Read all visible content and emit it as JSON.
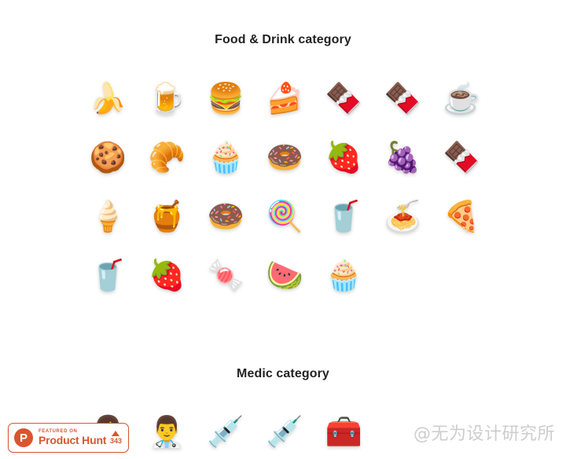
{
  "page": {
    "background_color": "#ffffff",
    "title_color": "#232323"
  },
  "sections": [
    {
      "id": "food",
      "title": "Food & Drink category",
      "rows": [
        [
          {
            "name": "banana-icon",
            "glyph": "🍌",
            "label": "banana"
          },
          {
            "name": "beer-mug-icon",
            "glyph": "🍺",
            "label": "beer mug"
          },
          {
            "name": "hamburger-icon",
            "glyph": "🍔",
            "label": "hamburger"
          },
          {
            "name": "heart-cake-icon",
            "glyph": "🍰",
            "label": "heart cake"
          },
          {
            "name": "chocolate-wrapper-icon",
            "glyph": "🍫",
            "label": "wrapped chocolate bar"
          },
          {
            "name": "chocolate-bar-icon",
            "glyph": "🍫",
            "label": "chocolate bar"
          },
          {
            "name": "coffee-cup-icon",
            "glyph": "☕",
            "label": "takeaway coffee cup"
          }
        ],
        [
          {
            "name": "cookies-icon",
            "glyph": "🍪",
            "label": "cookies"
          },
          {
            "name": "croissant-icon",
            "glyph": "🥐",
            "label": "croissant"
          },
          {
            "name": "cupcake-icon",
            "glyph": "🧁",
            "label": "cupcake"
          },
          {
            "name": "chocolate-donut-icon",
            "glyph": "🍩",
            "label": "chocolate donut"
          },
          {
            "name": "strawberry-icon",
            "glyph": "🍓",
            "label": "strawberries"
          },
          {
            "name": "grape-jelly-icon",
            "glyph": "🍇",
            "label": "purple jelly candy"
          },
          {
            "name": "ice-cream-bar-icon",
            "glyph": "🍫",
            "label": "chocolate ice cream bar"
          }
        ],
        [
          {
            "name": "ice-cream-cone-icon",
            "glyph": "🍦",
            "label": "ice cream cone"
          },
          {
            "name": "jam-jar-icon",
            "glyph": "🍯",
            "label": "jam jar"
          },
          {
            "name": "pink-donut-icon",
            "glyph": "🍩",
            "label": "pink sprinkle donut"
          },
          {
            "name": "lollipop-icon",
            "glyph": "🍭",
            "label": "lollipop"
          },
          {
            "name": "iced-drink-icon",
            "glyph": "🥤",
            "label": "iced drink cup"
          },
          {
            "name": "spaghetti-icon",
            "glyph": "🍝",
            "label": "spaghetti plate"
          },
          {
            "name": "pizza-slice-icon",
            "glyph": "🍕",
            "label": "pizza slice"
          }
        ],
        [
          {
            "name": "soda-can-icon",
            "glyph": "🥤",
            "label": "soda can"
          },
          {
            "name": "strawberries-icon",
            "glyph": "🍓",
            "label": "strawberries"
          },
          {
            "name": "candy-cane-icon",
            "glyph": "🍬",
            "label": "candy cane"
          },
          {
            "name": "watermelon-icon",
            "glyph": "🍉",
            "label": "watermelon slice"
          },
          {
            "name": "cupcake-wrapper-icon",
            "glyph": "🧁",
            "label": "red cupcake wrapper"
          }
        ]
      ]
    },
    {
      "id": "medic",
      "title": "Medic category",
      "rows": [
        [
          {
            "name": "nurse-icon",
            "glyph": "👩‍⚕️",
            "label": "nurse"
          },
          {
            "name": "doctor-icon",
            "glyph": "👨‍⚕️",
            "label": "doctor"
          },
          {
            "name": "syringe-icon",
            "glyph": "💉",
            "label": "syringe"
          },
          {
            "name": "filled-syringe-icon",
            "glyph": "💉",
            "label": "filled syringe"
          },
          {
            "name": "medical-kit-icon",
            "glyph": "🧰",
            "label": "medical kit"
          }
        ]
      ]
    }
  ],
  "product_hunt_badge": {
    "logo_letter": "P",
    "featured_text": "FEATURED ON",
    "name": "Product Hunt",
    "vote_count": "343",
    "accent_color": "#da552f"
  },
  "watermark": {
    "text": "@无为设计研究所",
    "color": "#c9c9c9"
  }
}
